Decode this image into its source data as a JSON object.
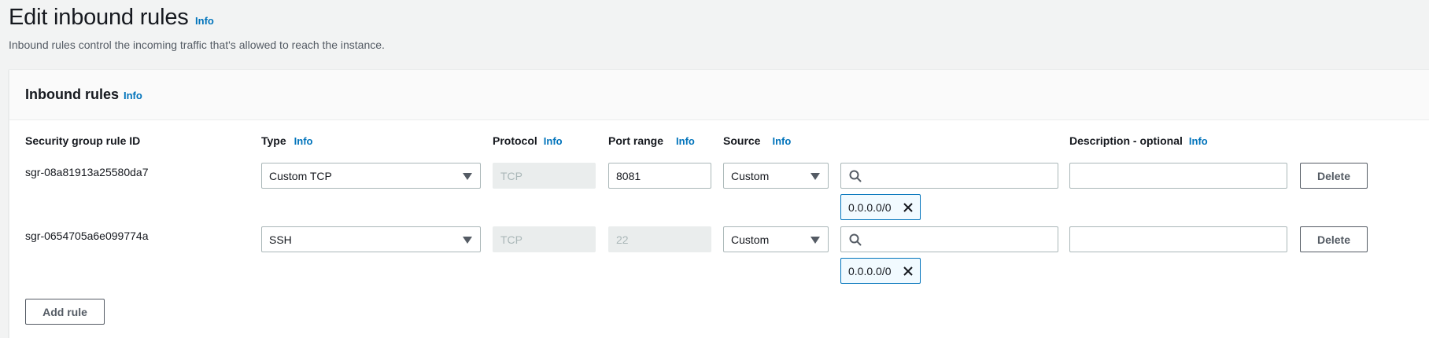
{
  "page": {
    "title": "Edit inbound rules",
    "title_info": "Info",
    "description": "Inbound rules control the incoming traffic that's allowed to reach the instance."
  },
  "panel": {
    "title": "Inbound rules",
    "title_info": "Info"
  },
  "columns": {
    "rule_id": "Security group rule ID",
    "type": "Type",
    "type_info": "Info",
    "protocol": "Protocol",
    "protocol_info": "Info",
    "port_range": "Port range",
    "port_range_info": "Info",
    "source": "Source",
    "source_info": "Info",
    "description": "Description - optional",
    "description_info": "Info"
  },
  "rules": [
    {
      "id": "sgr-08a81913a25580da7",
      "type": "Custom TCP",
      "protocol": "TCP",
      "port_range": "8081",
      "port_editable": true,
      "source": "Custom",
      "search_value": "",
      "cidr": "0.0.0.0/0",
      "description": "",
      "delete_label": "Delete"
    },
    {
      "id": "sgr-0654705a6e099774a",
      "type": "SSH",
      "protocol": "TCP",
      "port_range": "22",
      "port_editable": false,
      "source": "Custom",
      "search_value": "",
      "cidr": "0.0.0.0/0",
      "description": "",
      "delete_label": "Delete"
    }
  ],
  "add_rule_label": "Add rule",
  "colors": {
    "info_link": "#0073bb",
    "background": "#f2f3f3",
    "token_border": "#0073bb"
  },
  "icons": {
    "search": "search-icon",
    "remove": "close-icon",
    "dropdown": "caret-down-icon"
  }
}
